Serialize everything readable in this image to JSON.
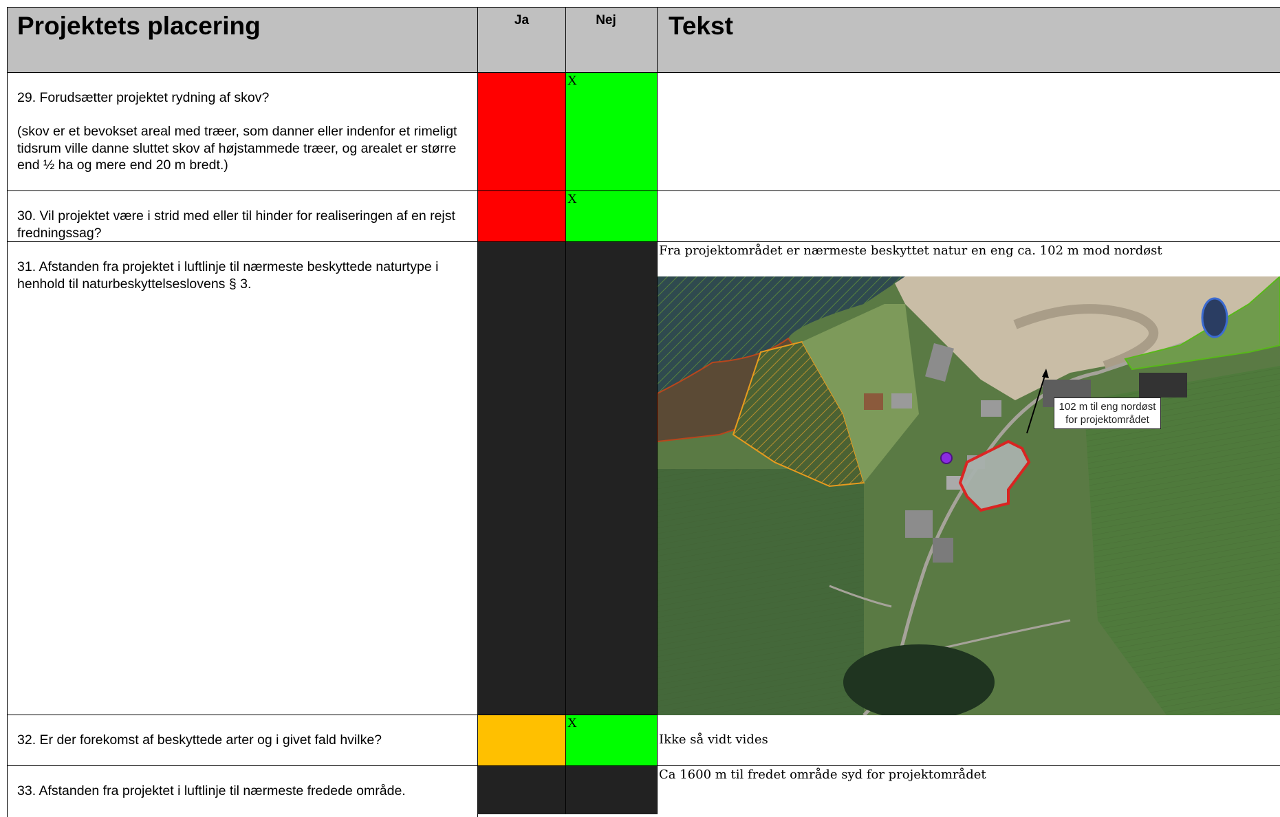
{
  "header": {
    "title": "Projektets placering",
    "ja": "Ja",
    "nej": "Nej",
    "tekst": "Tekst"
  },
  "rows": [
    {
      "question": "29. Forudsætter projektet rydning af skov?",
      "note": "(skov er et bevokset areal med træer, som danner eller indenfor et rimeligt tidsrum ville danne sluttet skov af højstammede træer, og arealet er større end ½ ha og mere end 20 m bredt.)",
      "ja_color": "#ff0000",
      "nej_mark": "X",
      "nej_color": "#00ff00",
      "text": ""
    },
    {
      "question": "30. Vil projektet være i strid med eller til hinder for realiseringen af en rejst fredningssag?",
      "ja_color": "#ff0000",
      "nej_mark": "X",
      "nej_color": "#00ff00",
      "text": ""
    },
    {
      "question": "31. Afstanden fra projektet i luftlinje til nærmeste beskyttede naturtype i henhold til naturbeskyttelseslovens § 3.",
      "ja_color": "#222222",
      "nej_color": "#222222",
      "text": "Fra projektområdet er nærmeste beskyttet natur en eng ca. 102 m mod nordøst",
      "map_label_line1": "102 m til eng nordøst",
      "map_label_line2": "for projektområdet"
    },
    {
      "question": "32. Er der forekomst af beskyttede arter og i givet fald hvilke?",
      "ja_color": "#ffc000",
      "nej_mark": "X",
      "nej_color": "#00ff00",
      "text": "Ikke så vidt vides"
    },
    {
      "question": "33. Afstanden fra projektet i luftlinje til nærmeste fredede område.",
      "ja_color": "#222222",
      "nej_color": "#222222",
      "text": "Ca 1600 m til fredet område syd for projektområdet"
    }
  ]
}
